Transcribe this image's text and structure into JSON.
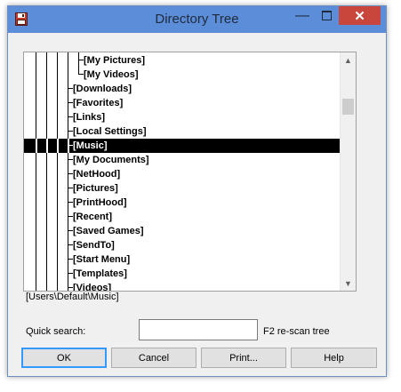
{
  "window": {
    "title": "Directory Tree",
    "minimize_glyph": "—",
    "close_glyph": "✕",
    "icon": "floppy-disk-icon"
  },
  "tree": {
    "items": [
      {
        "label": "[My Pictures]",
        "depth": 1,
        "selected": false
      },
      {
        "label": "[My Videos]",
        "depth": 1,
        "selected": false
      },
      {
        "label": "[Downloads]",
        "depth": 0,
        "selected": false
      },
      {
        "label": "[Favorites]",
        "depth": 0,
        "selected": false
      },
      {
        "label": "[Links]",
        "depth": 0,
        "selected": false
      },
      {
        "label": "[Local Settings]",
        "depth": 0,
        "selected": false
      },
      {
        "label": "[Music]",
        "depth": 0,
        "selected": true
      },
      {
        "label": "[My Documents]",
        "depth": 0,
        "selected": false
      },
      {
        "label": "[NetHood]",
        "depth": 0,
        "selected": false
      },
      {
        "label": "[Pictures]",
        "depth": 0,
        "selected": false
      },
      {
        "label": "[PrintHood]",
        "depth": 0,
        "selected": false
      },
      {
        "label": "[Recent]",
        "depth": 0,
        "selected": false
      },
      {
        "label": "[Saved Games]",
        "depth": 0,
        "selected": false
      },
      {
        "label": "[SendTo]",
        "depth": 0,
        "selected": false
      },
      {
        "label": "[Start Menu]",
        "depth": 0,
        "selected": false
      },
      {
        "label": "[Templates]",
        "depth": 0,
        "selected": false
      },
      {
        "label": "[Videos]",
        "depth": 0,
        "selected": false
      }
    ],
    "scroll_up_glyph": "▲",
    "scroll_down_glyph": "▼"
  },
  "path_label": "[Users\\Default\\Music]",
  "quick_search": {
    "label": "Quick search:",
    "value": "",
    "hint": "F2 re-scan tree"
  },
  "buttons": {
    "ok": "OK",
    "cancel": "Cancel",
    "print": "Print...",
    "help": "Help"
  }
}
